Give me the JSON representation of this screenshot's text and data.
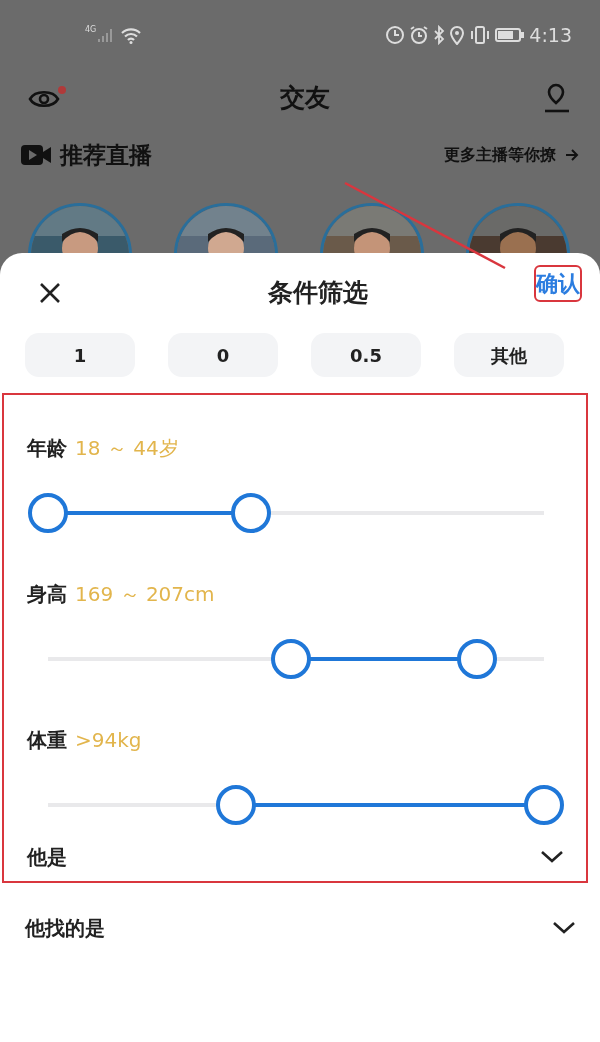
{
  "status_bar": {
    "network": "4G",
    "time": "4:13"
  },
  "header": {
    "title": "交友",
    "notification_dot": true
  },
  "live_section": {
    "title": "推荐直播",
    "more_link": "更多主播等你撩"
  },
  "sheet": {
    "title": "条件筛选",
    "confirm": {
      "label": "确认",
      "highlighted": true
    },
    "chips": [
      {
        "label": "1"
      },
      {
        "label": "0"
      },
      {
        "label": "0.5"
      },
      {
        "label": "其他"
      }
    ],
    "filters": [
      {
        "kind": "range",
        "label": "年龄",
        "value": "18 ～ 44岁",
        "highlighted": true,
        "thumbs": [
          {
            "level": 0
          },
          {
            "level": 0.41
          }
        ]
      },
      {
        "kind": "range",
        "label": "身高",
        "value": "169 ～ 207cm",
        "highlighted": true,
        "thumbs": [
          {
            "level": 0.49
          },
          {
            "level": 0.865
          }
        ]
      },
      {
        "kind": "range",
        "label": "体重",
        "value": ">94kg",
        "highlighted": true,
        "thumbs": [
          {
            "level": 0.38
          },
          {
            "level": 1
          }
        ]
      },
      {
        "kind": "select",
        "label": "他是",
        "highlighted": true,
        "expanded": false
      },
      {
        "kind": "select",
        "label": "他找的是",
        "highlighted": false,
        "expanded": false
      }
    ]
  }
}
